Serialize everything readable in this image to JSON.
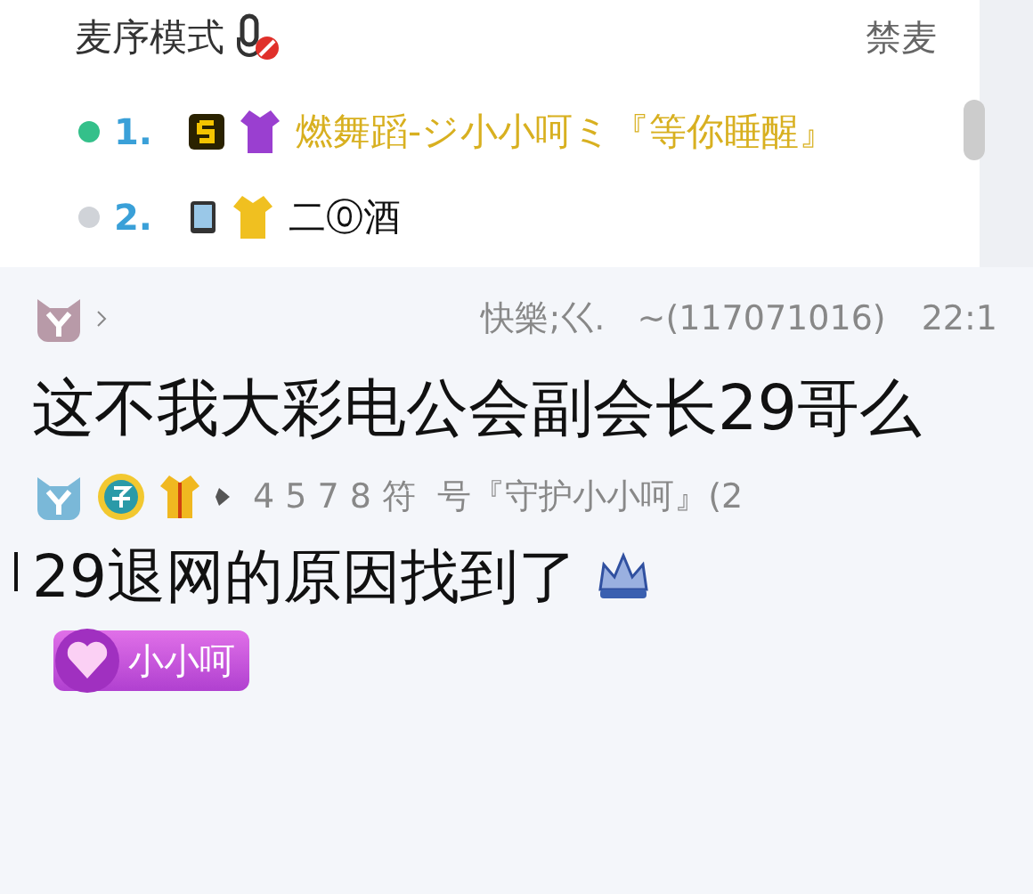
{
  "mic_queue": {
    "title": "麦序模式",
    "ban_button": "禁麦",
    "entries": [
      {
        "index": "1.",
        "online": true,
        "vip": true,
        "name": "燃舞蹈-ジ小小呵ミ『等你睡醒』"
      },
      {
        "index": "2.",
        "online": false,
        "vip": false,
        "name": "二⓪酒"
      }
    ]
  },
  "messages": [
    {
      "sender": "快樂;巜.   ~(117071016)",
      "time": "22:1",
      "text": "这不我大彩电公会副会长29哥么"
    },
    {
      "sender": "4 5 7 8 符  号『守护小小呵』(2",
      "text": "29退网的原因找到了",
      "badge": "小小呵"
    }
  ]
}
